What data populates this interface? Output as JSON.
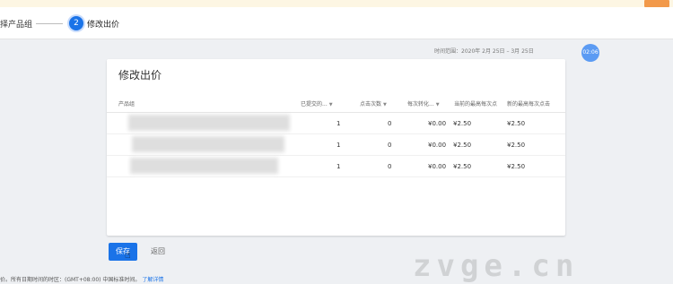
{
  "stepper": {
    "step1_label": "择产品组",
    "step2_number": "2",
    "step2_label": "修改出价"
  },
  "time_range": "时间范围：2020年 2月 25日 – 3月 25日",
  "avatar_text": "02:06",
  "card": {
    "title": "修改出价",
    "columns": {
      "product_name": "产品组",
      "col_a": "已提交的...",
      "col_b": "点击次数",
      "col_c": "每次转化...",
      "col_d": "当前的最高每次点",
      "col_e": "新的最高每次点击"
    },
    "rows": [
      {
        "a": "1",
        "b": "0",
        "c": "¥0.00",
        "d": "¥2.50",
        "e": "¥2.50"
      },
      {
        "a": "1",
        "b": "0",
        "c": "¥0.00",
        "d": "¥2.50",
        "e": "¥2.50"
      },
      {
        "a": "1",
        "b": "0",
        "c": "¥0.00",
        "d": "¥2.50",
        "e": "¥2.50"
      }
    ]
  },
  "buttons": {
    "save": "保存",
    "back": "返回"
  },
  "footer": {
    "note": "价。所有日期时间的时区：(GMT+08:00) 中国标准时间。",
    "link": "了解详情"
  },
  "watermark": "zvge.cn",
  "colors": {
    "primary": "#1a73e8",
    "background": "#eef0f3"
  }
}
